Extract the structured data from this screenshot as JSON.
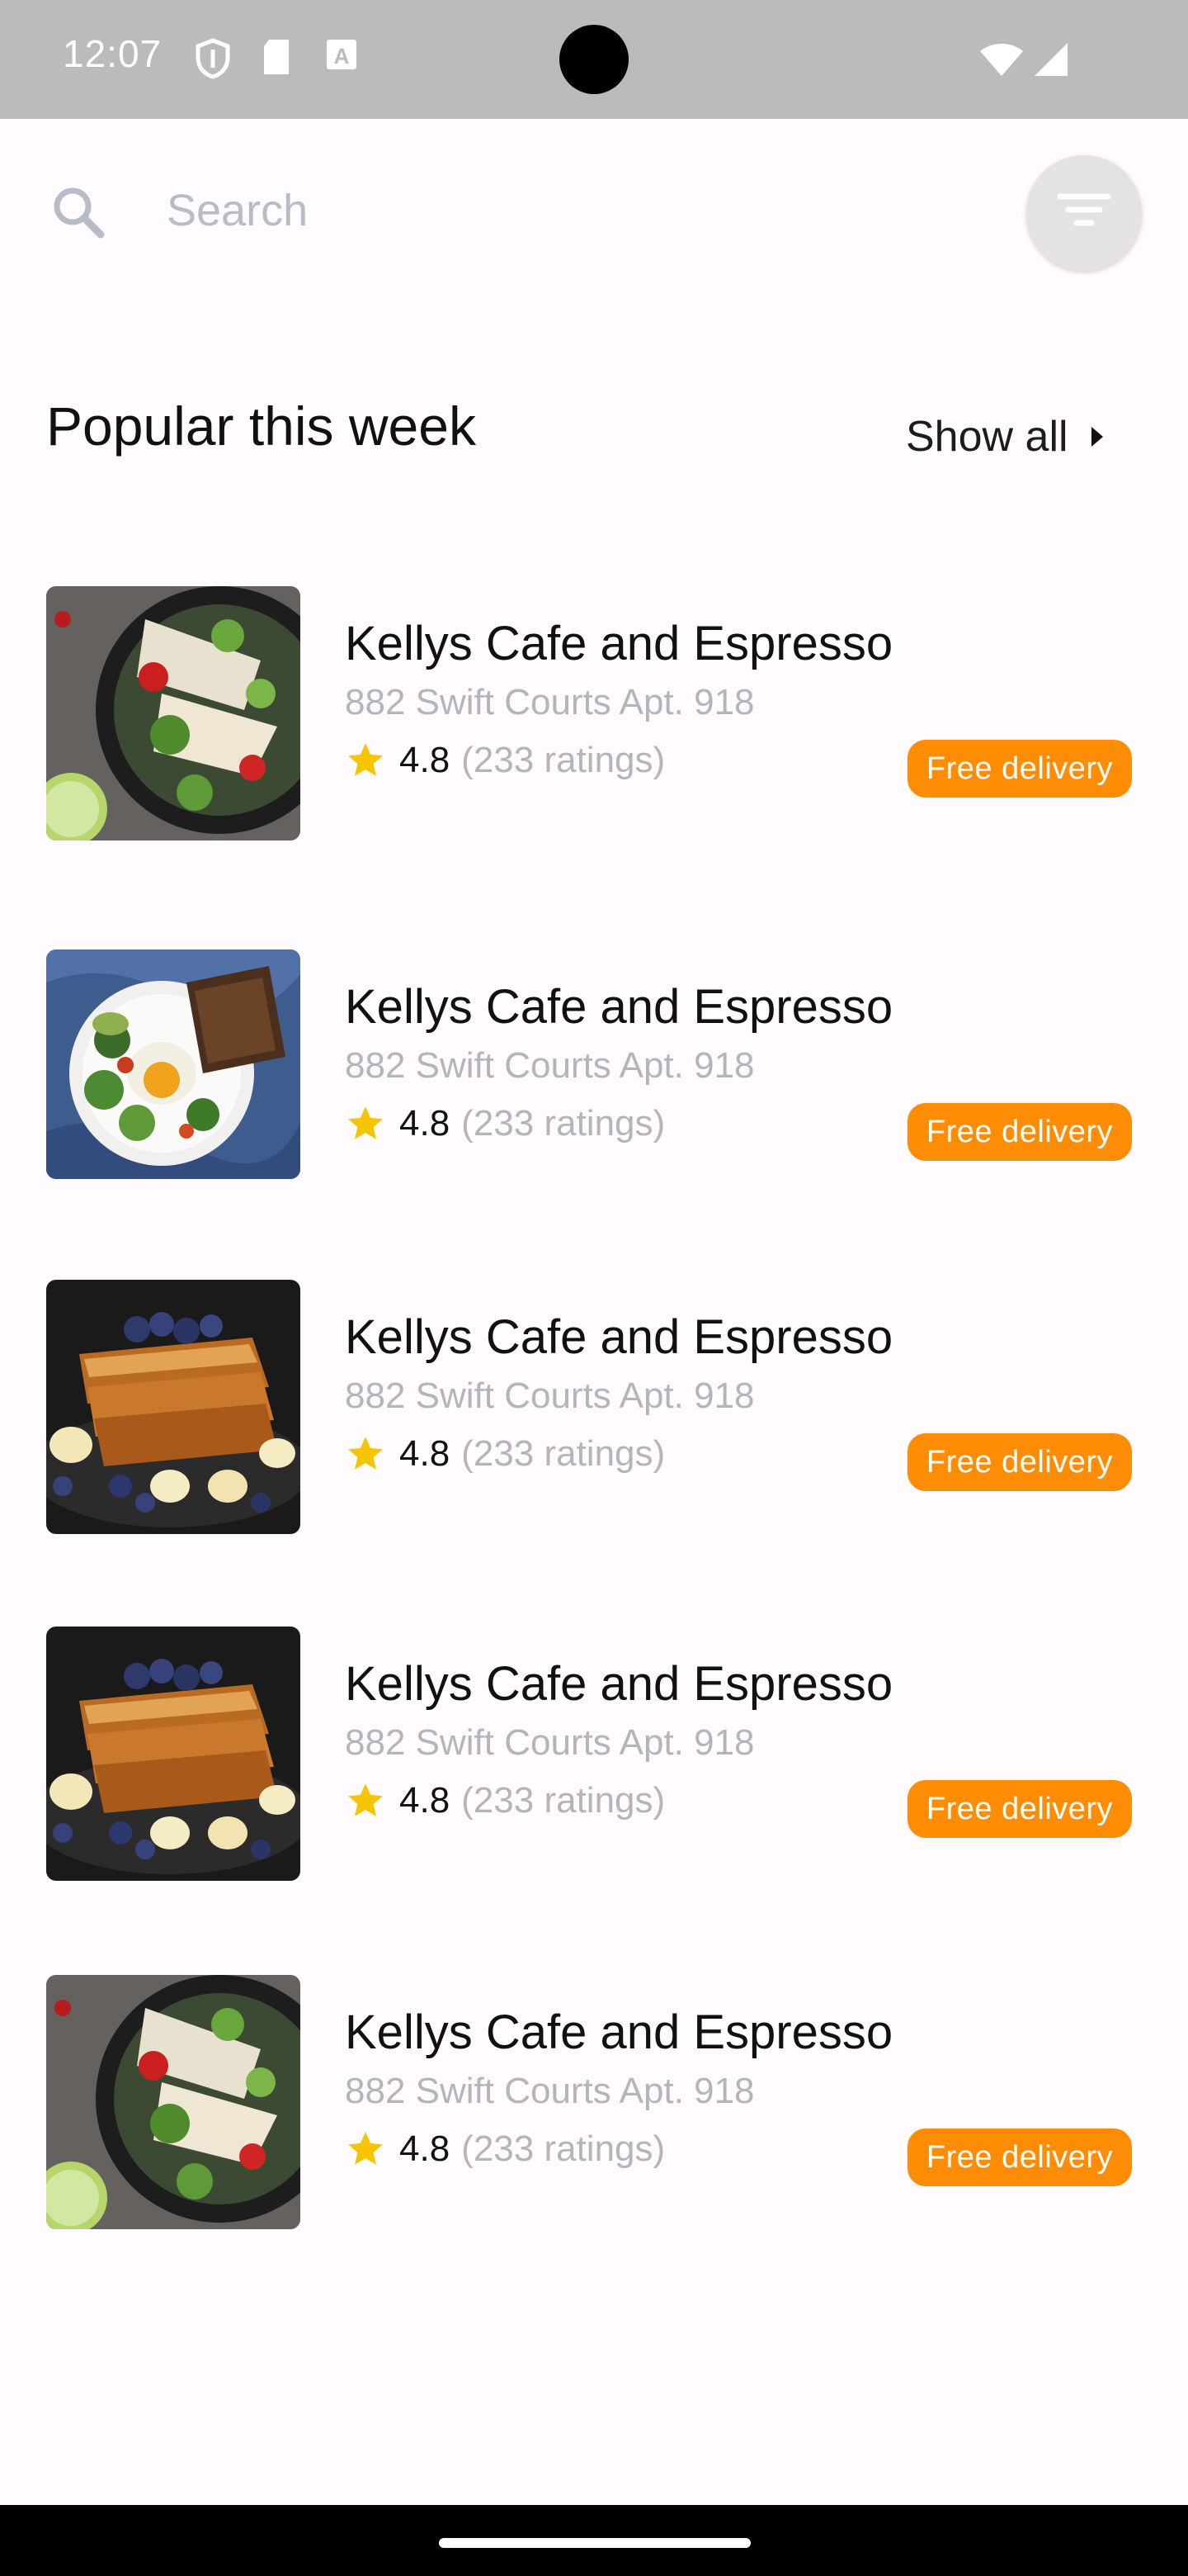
{
  "status_bar": {
    "time": "12:07",
    "icons": [
      "shield-icon",
      "sd-card-icon",
      "a-badge-icon",
      "wifi-icon",
      "signal-icon"
    ]
  },
  "search": {
    "placeholder": "Search"
  },
  "section": {
    "title": "Popular this week",
    "show_all_label": "Show all"
  },
  "colors": {
    "accent": "#ff8c05",
    "star": "#f7c400",
    "status_bar": "#bcbabd",
    "background": "#fffbfe"
  },
  "restaurants": [
    {
      "name": "Kellys Cafe and Espresso",
      "address": "882 Swift Courts Apt. 918",
      "rating": "4.8",
      "ratings_count": "(233 ratings)",
      "badge": "Free delivery",
      "image": "noodle-bowl"
    },
    {
      "name": "Kellys Cafe and Espresso",
      "address": "882 Swift Courts Apt. 918",
      "rating": "4.8",
      "ratings_count": "(233 ratings)",
      "badge": "Free delivery",
      "image": "poached-egg-plate"
    },
    {
      "name": "Kellys Cafe and Espresso",
      "address": "882 Swift Courts Apt. 918",
      "rating": "4.8",
      "ratings_count": "(233 ratings)",
      "badge": "Free delivery",
      "image": "french-toast"
    },
    {
      "name": "Kellys Cafe and Espresso",
      "address": "882 Swift Courts Apt. 918",
      "rating": "4.8",
      "ratings_count": "(233 ratings)",
      "badge": "Free delivery",
      "image": "french-toast"
    },
    {
      "name": "Kellys Cafe and Espresso",
      "address": "882 Swift Courts Apt. 918",
      "rating": "4.8",
      "ratings_count": "(233 ratings)",
      "badge": "Free delivery",
      "image": "noodle-bowl"
    }
  ]
}
